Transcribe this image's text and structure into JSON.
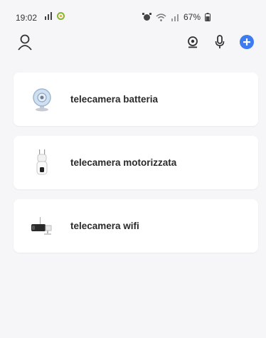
{
  "status": {
    "time": "19:02",
    "battery": "67%",
    "icons": [
      "signal-bars-icon",
      "android-app-icon",
      "alarm-icon",
      "wifi-icon",
      "cell-signal-icon",
      "battery-icon"
    ]
  },
  "toolbar": {
    "icons": [
      "user-icon",
      "camera-scan-icon",
      "microphone-icon",
      "add-icon"
    ],
    "accent": "#3d7bf0"
  },
  "devices": [
    {
      "name": "telecamera batteria",
      "icon": "round-camera-icon"
    },
    {
      "name": "telecamera motorizzata",
      "icon": "ptz-camera-icon"
    },
    {
      "name": "telecamera wifi",
      "icon": "bullet-camera-icon"
    }
  ]
}
